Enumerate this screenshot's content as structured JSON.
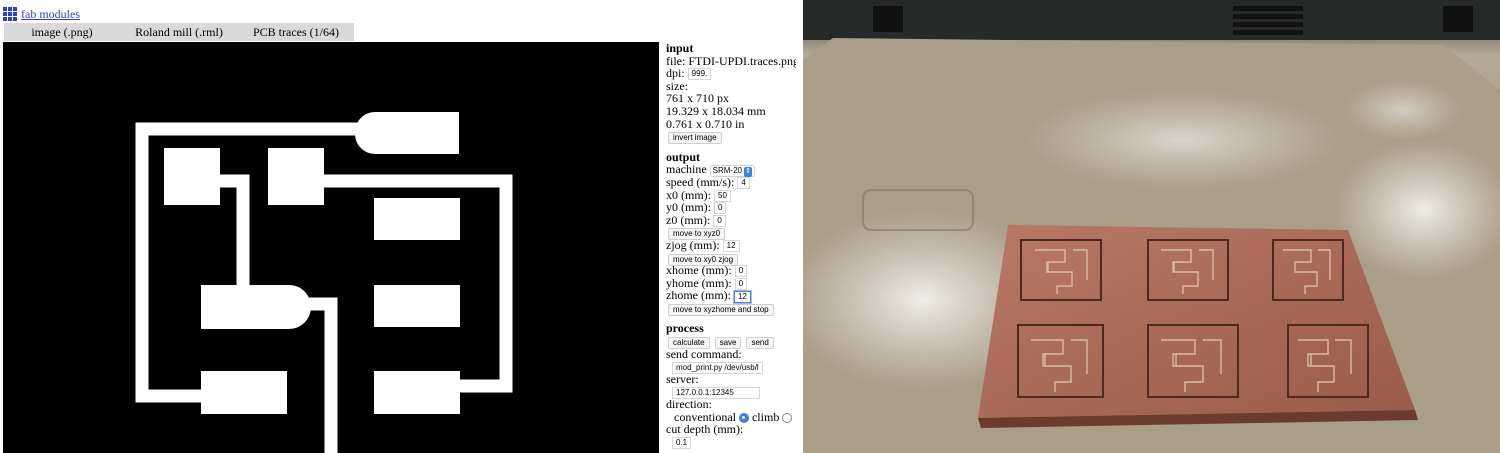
{
  "app": {
    "title": "fab modules"
  },
  "menu": {
    "items": [
      "image (.png)",
      "Roland mill (.rml)",
      "PCB traces (1/64)"
    ]
  },
  "input": {
    "heading": "input",
    "file": "file: FTDI-UPDI.traces.png",
    "dpi_label": "dpi:",
    "dpi_value": "999.",
    "size_label": "size:",
    "size_px": "761 x 710 px",
    "size_mm": "19.329 x 18.034 mm",
    "size_in": "0.761 x 0.710 in",
    "invert_button": "invert image"
  },
  "output": {
    "heading": "output",
    "machine_label": "machine",
    "machine_value": "SRM-20",
    "speed_label": "speed (mm/s):",
    "speed_value": "4",
    "x0_label": "x0 (mm):",
    "x0_value": "50",
    "y0_label": "y0 (mm):",
    "y0_value": "0",
    "z0_label": "z0 (mm):",
    "z0_value": "0",
    "move_xyz0_button": "move to xyz0",
    "zjog_label": "zjog (mm):",
    "zjog_value": "12",
    "move_zjog_button": "move to xy0 zjog",
    "xhome_label": "xhome (mm):",
    "xhome_value": "0",
    "yhome_label": "yhome (mm):",
    "yhome_value": "0",
    "zhome_label": "zhome (mm):",
    "zhome_value": "12",
    "move_home_button": "move to xyzhome and stop"
  },
  "process": {
    "heading": "process",
    "calculate_button": "calculate",
    "save_button": "save",
    "send_button": "send",
    "send_command_label": "send command:",
    "send_command_value": "mod_print.py /dev/usb/l",
    "server_label": "server:",
    "server_value": "127.0.0.1:12345",
    "direction_label": "direction:",
    "conventional_label": "conventional",
    "climb_label": "climb",
    "cut_depth_label": "cut depth (mm):",
    "cut_depth_value": "0.1"
  },
  "colors": {
    "link": "#2b3fc9",
    "radio_accent": "#3b7fe0",
    "pcb_copper": "#b06a5a"
  }
}
